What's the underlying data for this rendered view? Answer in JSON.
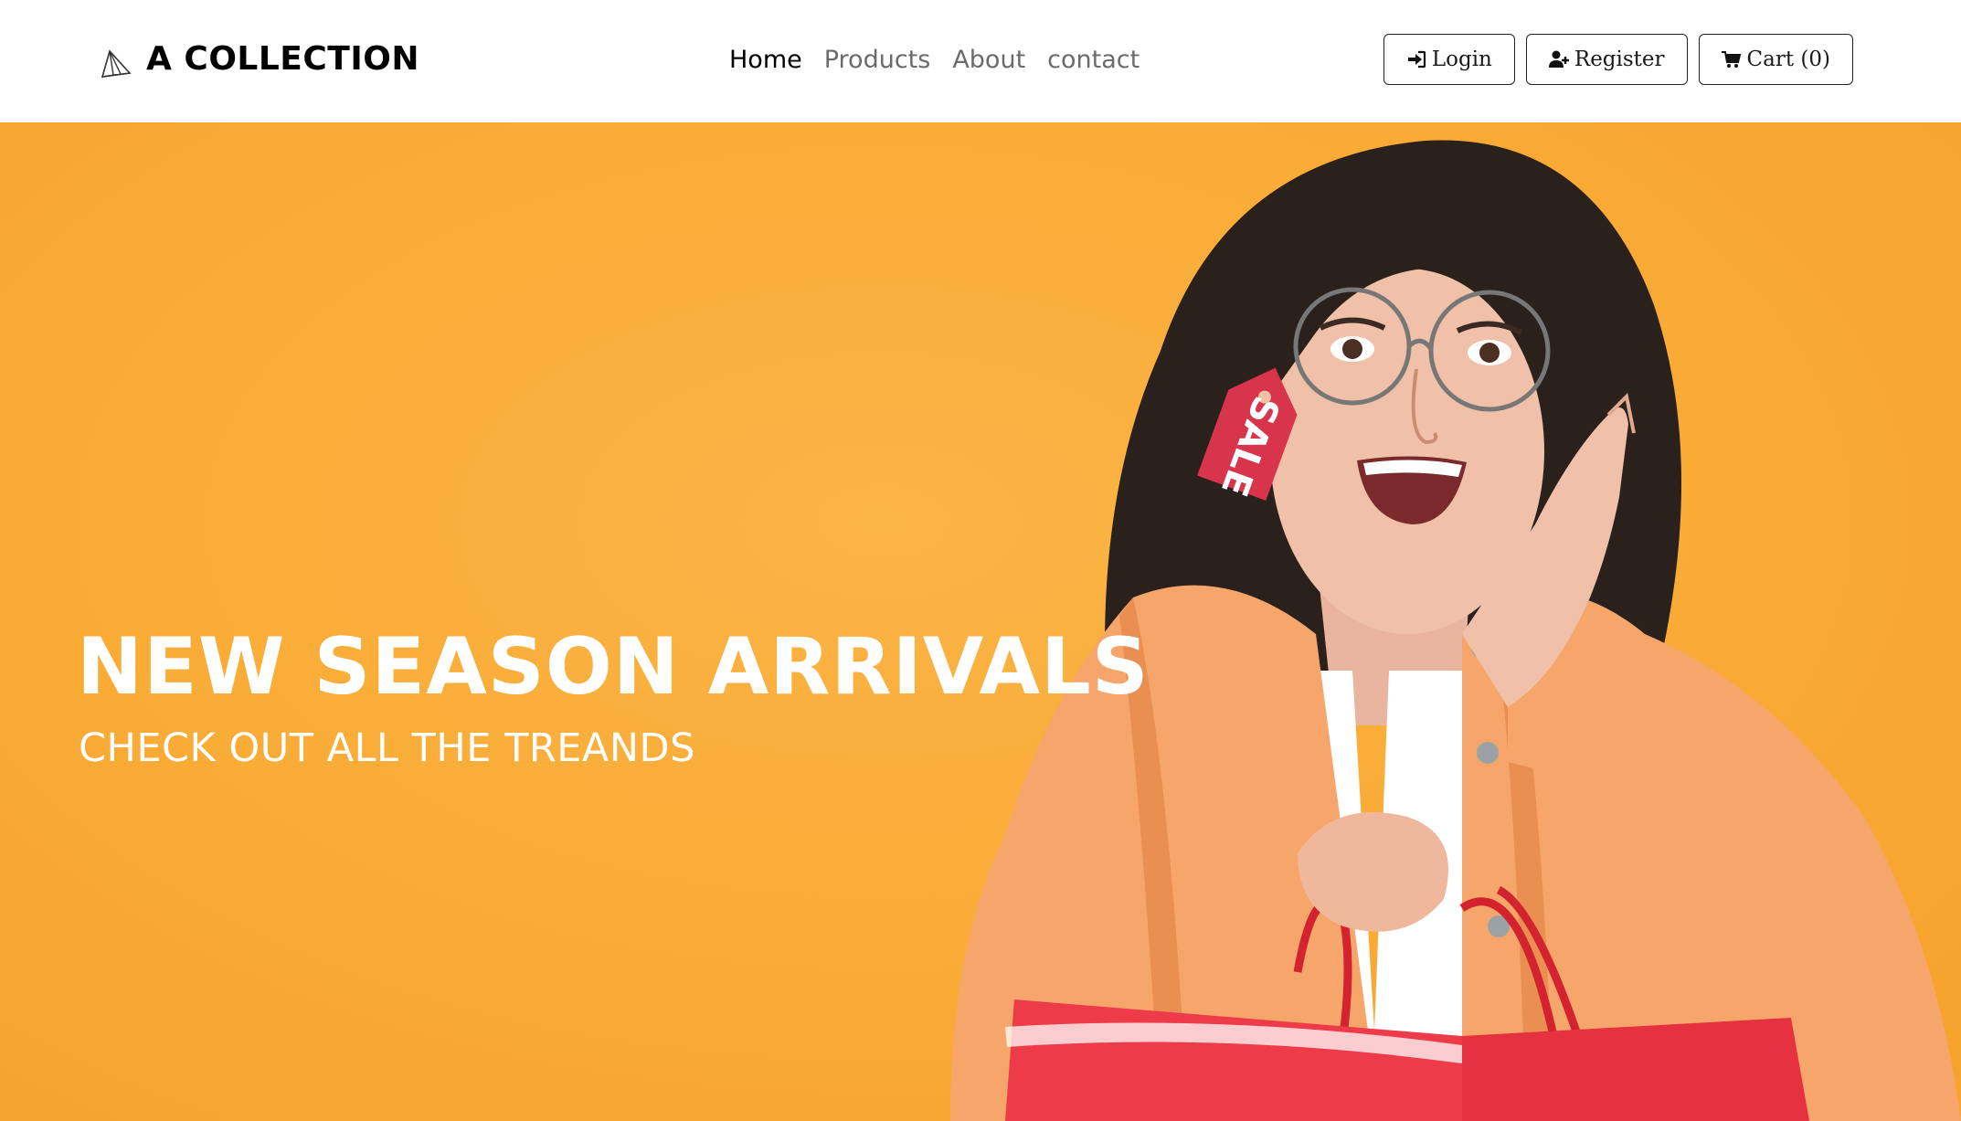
{
  "brand": {
    "name": "A COLLECTION",
    "icon": "paper-plane-icon"
  },
  "nav": {
    "links": [
      {
        "label": "Home",
        "active": true
      },
      {
        "label": "Products",
        "active": false
      },
      {
        "label": "About",
        "active": false
      },
      {
        "label": "contact",
        "active": false
      }
    ]
  },
  "actions": {
    "login": {
      "label": "Login",
      "icon": "sign-in-icon"
    },
    "register": {
      "label": "Register",
      "icon": "user-plus-icon"
    },
    "cart": {
      "label": "Cart (0)",
      "icon": "shopping-cart-icon"
    }
  },
  "hero": {
    "title": "NEW SEASON ARRIVALS",
    "subtitle": "CHECK OUT ALL THE TREANDS",
    "tag_text": "SALE",
    "background_color": "#f9ab35"
  },
  "colors": {
    "hero_bg": "#f9ab35",
    "text_dark": "#000000",
    "text_muted": "#6b6b6b",
    "sale_tag": "#d8354c",
    "jacket": "#f7a66b",
    "bag": "#ee3b49"
  }
}
